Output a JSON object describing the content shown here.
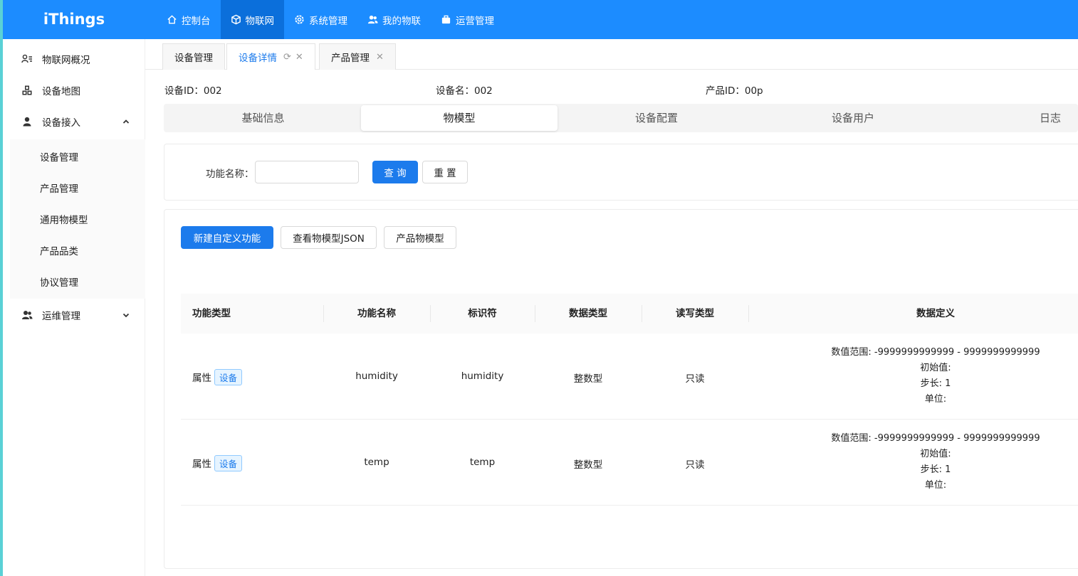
{
  "app": {
    "logo": "iThings"
  },
  "topnav": [
    {
      "label": "控制台",
      "icon": "home-icon",
      "active": false
    },
    {
      "label": "物联网",
      "icon": "cube-icon",
      "active": true
    },
    {
      "label": "系统管理",
      "icon": "gear-icon",
      "active": false
    },
    {
      "label": "我的物联",
      "icon": "users-icon",
      "active": false
    },
    {
      "label": "运营管理",
      "icon": "briefcase-icon",
      "active": false
    }
  ],
  "sidebar": {
    "items": [
      {
        "label": "物联网概况",
        "icon": "user-list-icon"
      },
      {
        "label": "设备地图",
        "icon": "cubes-icon"
      },
      {
        "label": "设备接入",
        "icon": "user-icon",
        "expanded": true
      },
      {
        "label": "运维管理",
        "icon": "users-icon",
        "expanded": false
      }
    ],
    "sub_items": [
      {
        "label": "设备管理"
      },
      {
        "label": "产品管理"
      },
      {
        "label": "通用物模型"
      },
      {
        "label": "产品品类"
      },
      {
        "label": "协议管理"
      }
    ]
  },
  "tabs": [
    {
      "label": "设备管理",
      "active": false
    },
    {
      "label": "设备详情",
      "active": true
    },
    {
      "label": "产品管理",
      "active": false
    }
  ],
  "device_info": {
    "id_label": "设备ID：002",
    "name_label": "设备名：002",
    "product_label": "产品ID：00p"
  },
  "inner_tabs": [
    {
      "label": "基础信息",
      "active": false
    },
    {
      "label": "物模型",
      "active": true
    },
    {
      "label": "设备配置",
      "active": false
    },
    {
      "label": "设备用户",
      "active": false
    },
    {
      "label": "日志",
      "active": false
    }
  ],
  "search": {
    "label": "功能名称：",
    "value": "",
    "query_button": "查 询",
    "reset_button": "重 置"
  },
  "actions": {
    "new_custom": "新建自定义功能",
    "view_json": "查看物模型JSON",
    "product_model": "产品物模型"
  },
  "table": {
    "columns": [
      "功能类型",
      "功能名称",
      "标识符",
      "数据类型",
      "读写类型",
      "数据定义"
    ],
    "rows": [
      {
        "type": "属性",
        "tag": "设备",
        "name": "humidity",
        "identifier": "humidity",
        "data_type": "整数型",
        "rw": "只读",
        "def_range": "数值范围: -9999999999999 - 9999999999999",
        "def_init": "初始值:",
        "def_step": "步长: 1",
        "def_unit": "单位:"
      },
      {
        "type": "属性",
        "tag": "设备",
        "name": "temp",
        "identifier": "temp",
        "data_type": "整数型",
        "rw": "只读",
        "def_range": "数值范围: -9999999999999 - 9999999999999",
        "def_init": "初始值:",
        "def_step": "步长: 1",
        "def_unit": "单位:"
      }
    ]
  },
  "colors": {
    "primary": "#1c8cff",
    "primary_dark": "#0b6fdb",
    "accent_left": "#5ad1d6"
  }
}
